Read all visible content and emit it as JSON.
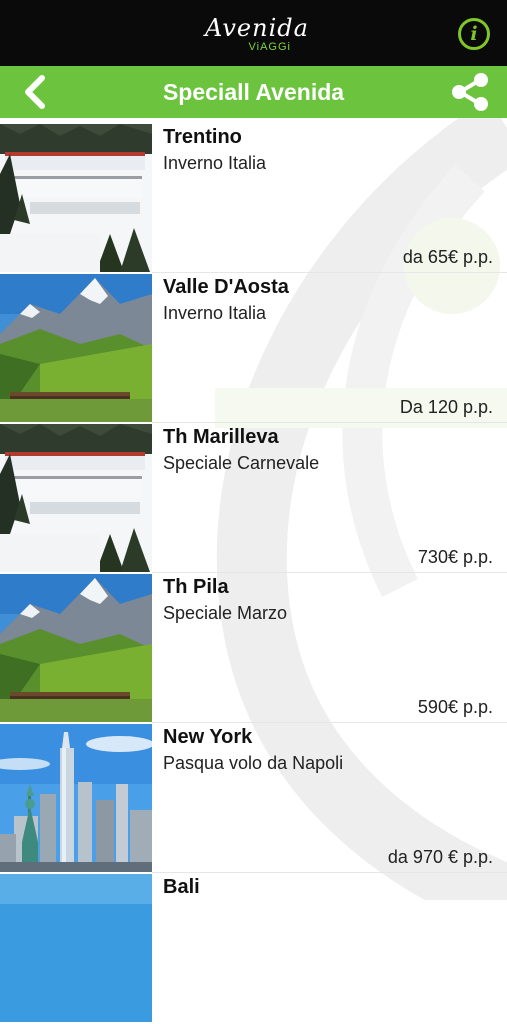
{
  "header": {
    "logo_main": "Avenida",
    "logo_sub": "ViAGGi",
    "info_label": "i"
  },
  "nav": {
    "title": "Speciall Avenida"
  },
  "items": [
    {
      "title": "Trentino",
      "subtitle": "Inverno Italia",
      "price": "da 65€ p.p.",
      "image": "ski-resort"
    },
    {
      "title": "Valle D'Aosta",
      "subtitle": "Inverno Italia",
      "price": "Da 120 p.p.",
      "image": "mountain-valley"
    },
    {
      "title": "Th Marilleva",
      "subtitle": "Speciale Carnevale",
      "price": "730€ p.p.",
      "image": "ski-resort"
    },
    {
      "title": "Th Pila",
      "subtitle": "Speciale Marzo",
      "price": "590€ p.p.",
      "image": "mountain-valley"
    },
    {
      "title": "New York",
      "subtitle": "Pasqua volo da Napoli",
      "price": "da 970 € p.p.",
      "image": "new-york-skyline"
    },
    {
      "title": "Bali",
      "subtitle": "",
      "price": "",
      "image": "beach"
    }
  ],
  "colors": {
    "header_bg": "#0a0a0a",
    "nav_bg": "#6cc43e",
    "accent_green": "#7fc728"
  }
}
